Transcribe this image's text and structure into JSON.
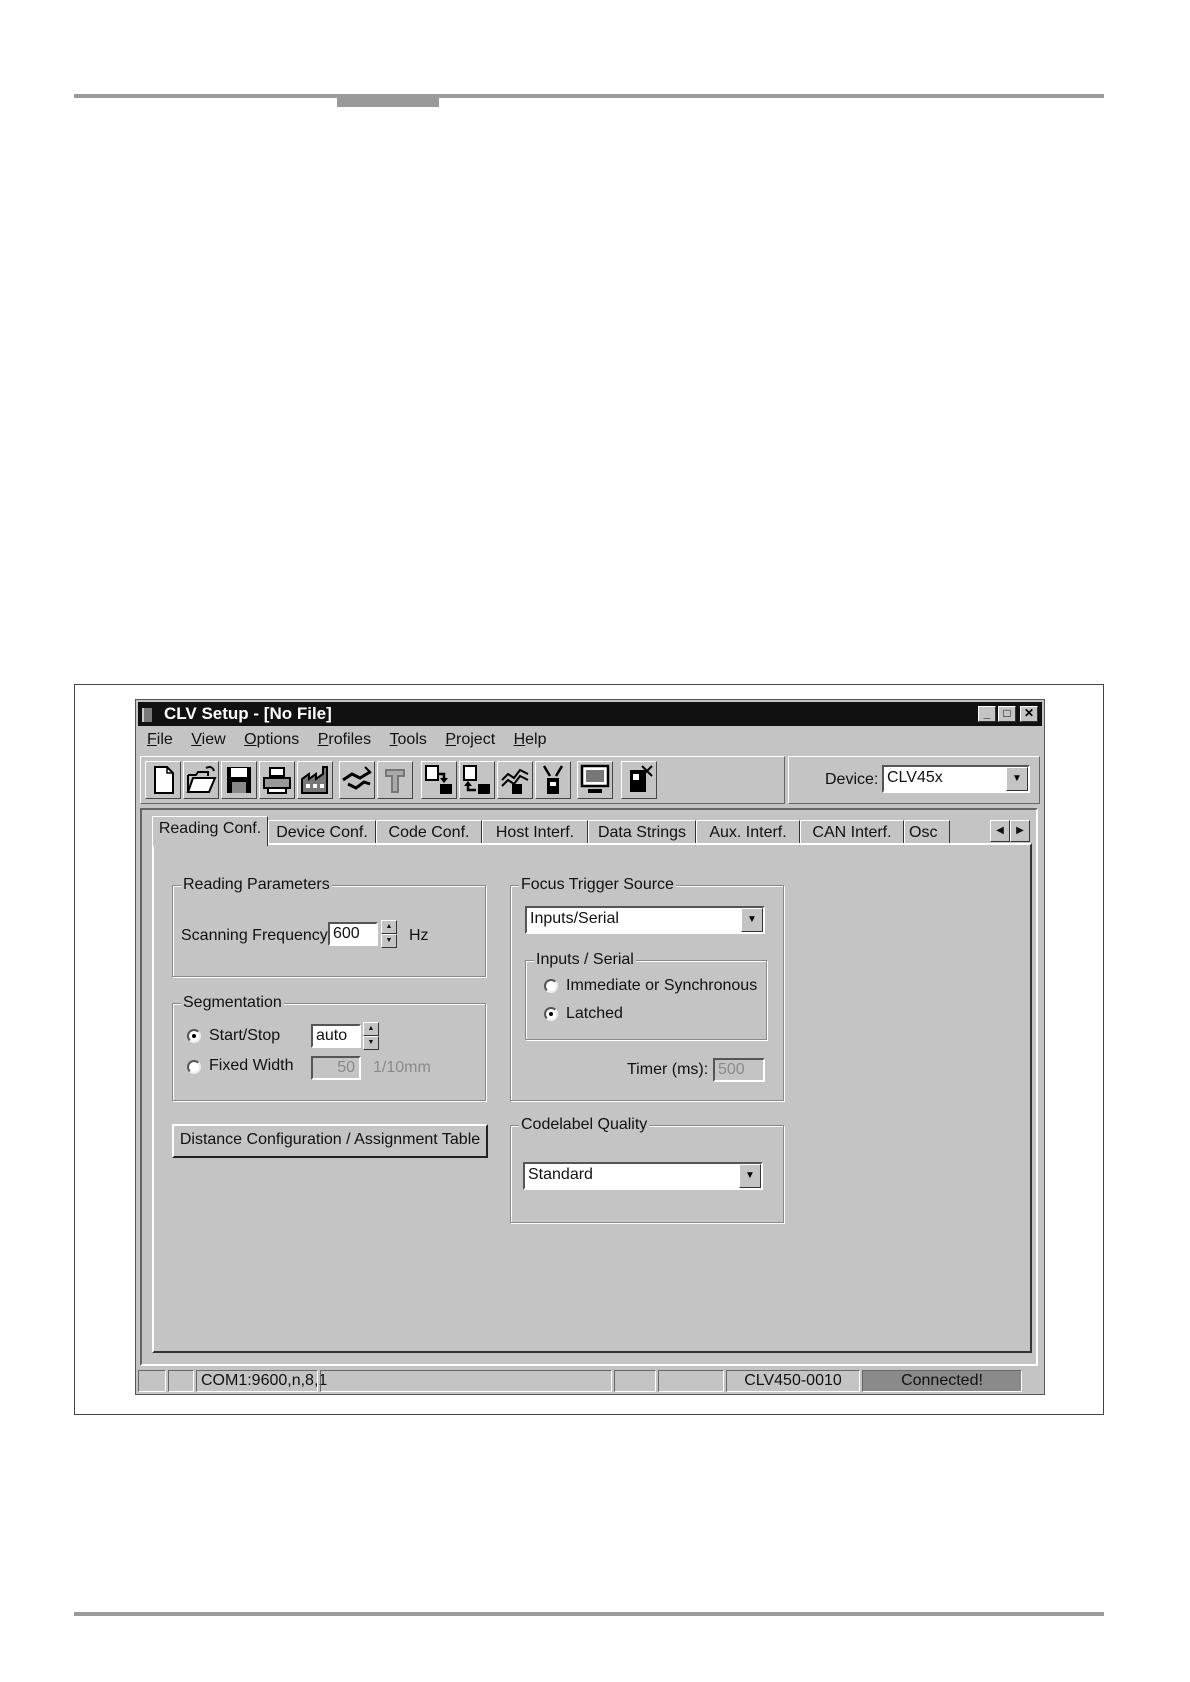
{
  "window": {
    "title": "CLV Setup - [No File]",
    "min_glyph": "_",
    "max_glyph": "□",
    "close_glyph": "✕"
  },
  "menu": [
    "File",
    "View",
    "Options",
    "Profiles",
    "Tools",
    "Project",
    "Help"
  ],
  "toolbar": {
    "icons": [
      "new-file-icon",
      "open-folder-icon",
      "save-disk-icon",
      "print-icon",
      "factory-icon",
      "handshake-icon",
      "disconnect-icon",
      "download-to-device-icon",
      "upload-from-device-icon",
      "chart-icon",
      "plug-icon",
      "monitor-icon",
      "device-icon"
    ]
  },
  "device": {
    "label": "Device:",
    "value": "CLV45x"
  },
  "tabs": [
    "Reading Conf.",
    "Device Conf.",
    "Code Conf.",
    "Host Interf.",
    "Data Strings",
    "Aux. Interf.",
    "CAN Interf.",
    "Osc"
  ],
  "tab_scroll": {
    "left": "◀",
    "right": "▶"
  },
  "reading_parameters": {
    "title": "Reading Parameters",
    "scanning_frequency_label": "Scanning Frequency",
    "scanning_frequency_value": "600",
    "unit": "Hz"
  },
  "segmentation": {
    "title": "Segmentation",
    "start_stop_label": "Start/Stop",
    "start_stop_value": "auto",
    "fixed_width_label": "Fixed Width",
    "fixed_width_value": "50",
    "fixed_width_unit": "1/10mm",
    "selected": "start_stop"
  },
  "distance_button": "Distance Configuration / Assignment Table",
  "focus_trigger": {
    "title": "Focus Trigger Source",
    "value": "Inputs/Serial",
    "inputs_serial_title": "Inputs / Serial",
    "option_immediate": "Immediate or Synchronous",
    "option_latched": "Latched",
    "selected": "latched",
    "timer_label": "Timer (ms):",
    "timer_value": "500"
  },
  "codelabel_quality": {
    "title": "Codelabel Quality",
    "value": "Standard"
  },
  "statusbar": {
    "port": "COM1:9600,n,8,1",
    "device": "CLV450-0010",
    "status": "Connected!"
  },
  "dropdown_glyph": "▼",
  "spin_up": "▲",
  "spin_down": "▼"
}
